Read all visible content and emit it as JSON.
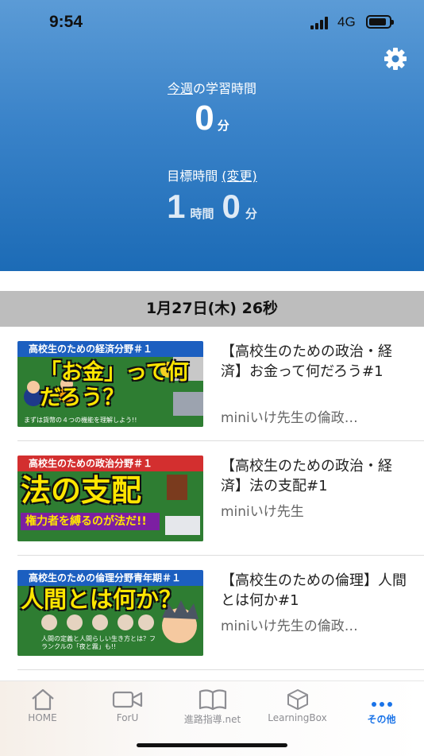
{
  "status": {
    "time": "9:54",
    "network": "4G"
  },
  "header": {
    "week_prefix": "今週",
    "week_suffix": "の学習時間",
    "week_value": "0",
    "week_unit": "分",
    "goal_label": "目標時間",
    "goal_link": "(変更)",
    "goal_hours": "1",
    "goal_hours_unit": "時間",
    "goal_minutes": "0",
    "goal_minutes_unit": "分"
  },
  "date_bar": "1月27日(木) 26秒",
  "videos": [
    {
      "thumb_band": "高校生のための経済分野＃１",
      "thumb_text": "「お金」って何だろう？",
      "thumb_caption": "まずは貨幣の４つの機能を理解しよう!!",
      "title": "【高校生のための政治・経済】お金って何だろう#1",
      "channel": "miniいけ先生の倫政…"
    },
    {
      "thumb_band": "高校生のための政治分野＃１",
      "thumb_text": "法の支配",
      "thumb_caption": "権力者を縛るのが法だ!!",
      "title": "【高校生のための政治・経済】法の支配#1",
      "channel": "miniいけ先生"
    },
    {
      "thumb_band": "高校生のための倫理分野青年期＃１",
      "thumb_text": "人間とは何か？",
      "thumb_caption": "人間の定義と人間らしい生き方とは？フランクルの「夜と霧」も!!",
      "title": "【高校生のための倫理】人間とは何か#1",
      "channel": "miniいけ先生の倫政…"
    }
  ],
  "tabs": [
    {
      "label": "HOME",
      "icon": "home-icon"
    },
    {
      "label": "ForU",
      "icon": "video-camera-icon"
    },
    {
      "label": "進路指導.net",
      "icon": "book-icon"
    },
    {
      "label": "LearningBox",
      "icon": "box-icon"
    },
    {
      "label": "その他",
      "icon": "more-icon",
      "active": true
    }
  ],
  "colors": {
    "header_top": "#5b9bd6",
    "header_bottom": "#1c6bb6",
    "active_tab": "#1a73e8"
  }
}
